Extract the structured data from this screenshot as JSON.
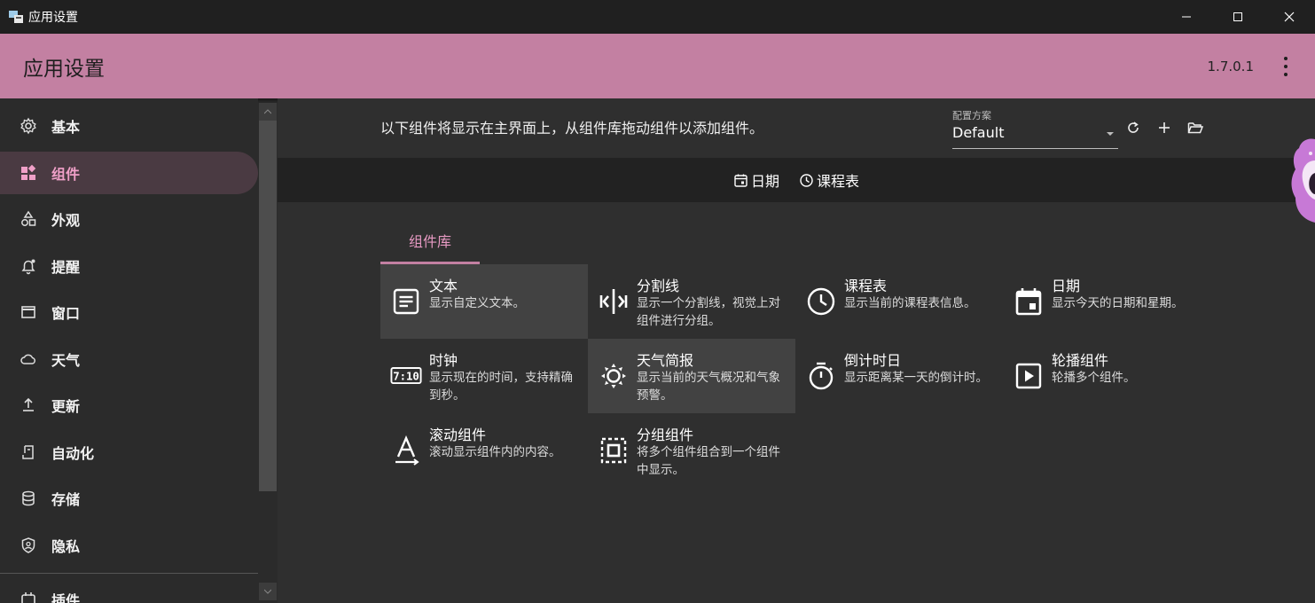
{
  "window": {
    "title": "应用设置"
  },
  "appbar": {
    "title": "应用设置",
    "version": "1.7.0.1"
  },
  "sidebar": {
    "items": [
      {
        "label": "基本",
        "icon": "gear-icon"
      },
      {
        "label": "组件",
        "icon": "widgets-icon",
        "active": true
      },
      {
        "label": "外观",
        "icon": "shapes-icon"
      },
      {
        "label": "提醒",
        "icon": "bell-icon"
      },
      {
        "label": "窗口",
        "icon": "window-icon"
      },
      {
        "label": "天气",
        "icon": "cloud-icon"
      },
      {
        "label": "更新",
        "icon": "upload-icon"
      },
      {
        "label": "自动化",
        "icon": "automation-icon"
      },
      {
        "label": "存储",
        "icon": "database-icon"
      },
      {
        "label": "隐私",
        "icon": "shield-icon"
      },
      {
        "label": "插件",
        "icon": "plugin-icon"
      }
    ]
  },
  "main": {
    "intro": "以下组件将显示在主界面上，从组件库拖动组件以添加组件。",
    "profile": {
      "caption": "配置方案",
      "value": "Default"
    },
    "preview": [
      {
        "label": "日期",
        "icon": "calendar-icon"
      },
      {
        "label": "课程表",
        "icon": "clock-icon"
      }
    ],
    "tab": "组件库",
    "widgets": [
      {
        "name": "文本",
        "desc": "显示自定义文本。",
        "icon": "text-icon"
      },
      {
        "name": "分割线",
        "desc": "显示一个分割线，视觉上对组件进行分组。",
        "icon": "separator-icon"
      },
      {
        "name": "课程表",
        "desc": "显示当前的课程表信息。",
        "icon": "clock-icon"
      },
      {
        "name": "日期",
        "desc": "显示今天的日期和星期。",
        "icon": "calendar-icon"
      },
      {
        "name": "时钟",
        "desc": "显示现在的时间，支持精确到秒。",
        "icon": "digital-clock-icon"
      },
      {
        "name": "天气简报",
        "desc": "显示当前的天气概况和气象预警。",
        "icon": "sun-icon"
      },
      {
        "name": "倒计时日",
        "desc": "显示距离某一天的倒计时。",
        "icon": "timer-icon"
      },
      {
        "name": "轮播组件",
        "desc": "轮播多个组件。",
        "icon": "play-icon"
      },
      {
        "name": "滚动组件",
        "desc": "滚动显示组件内的内容。",
        "icon": "scroll-text-icon"
      },
      {
        "name": "分组组件",
        "desc": "将多个组件组合到一个组件中显示。",
        "icon": "group-icon"
      }
    ]
  },
  "colors": {
    "accent": "#c380a2",
    "accent_text": "#e79ac3",
    "background": "#2f2f2f",
    "titlebar": "#202020"
  }
}
